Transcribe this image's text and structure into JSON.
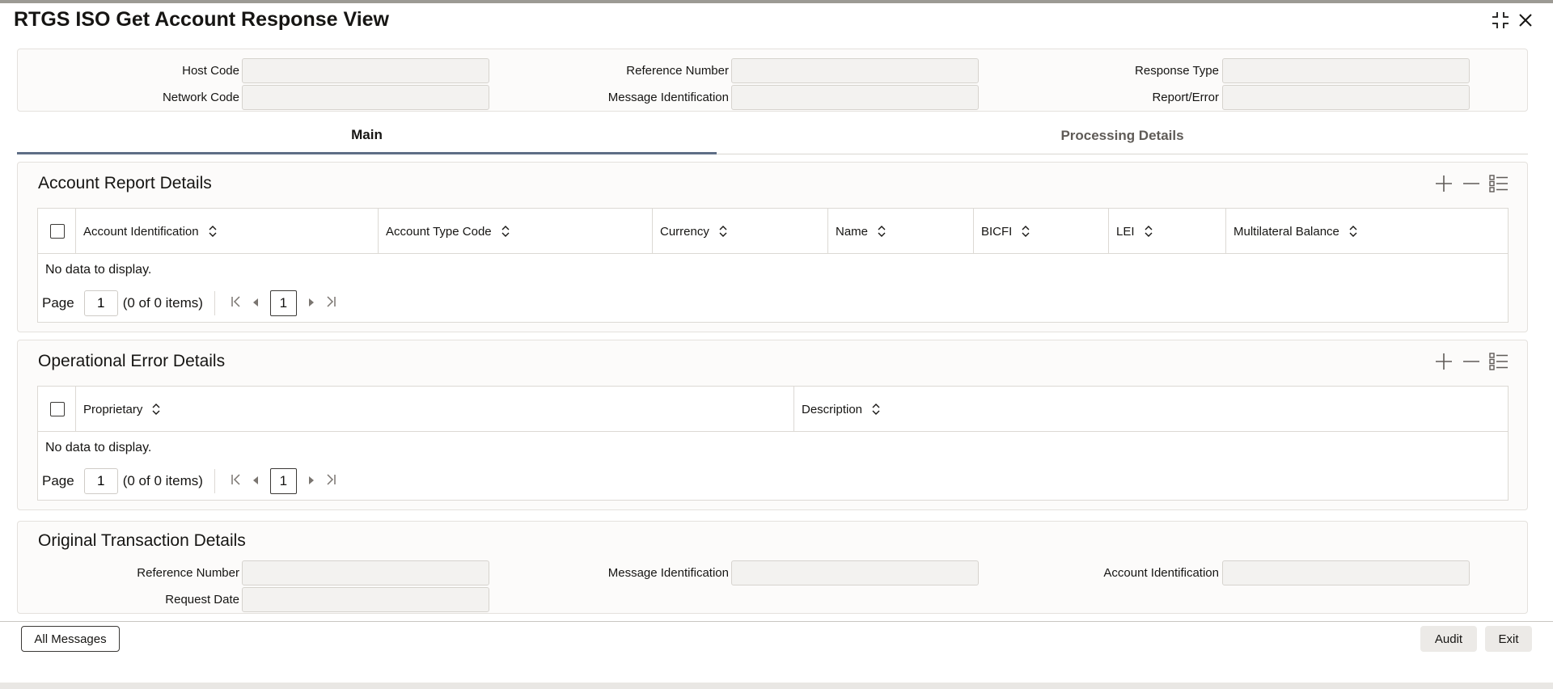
{
  "window": {
    "title": "RTGS ISO Get Account Response View"
  },
  "header_fields": {
    "host_code": {
      "label": "Host Code",
      "value": ""
    },
    "network_code": {
      "label": "Network Code",
      "value": ""
    },
    "reference_number": {
      "label": "Reference Number",
      "value": ""
    },
    "message_identification": {
      "label": "Message Identification",
      "value": ""
    },
    "response_type": {
      "label": "Response Type",
      "value": ""
    },
    "report_error": {
      "label": "Report/Error",
      "value": ""
    }
  },
  "tabs": [
    {
      "label": "Main",
      "active": true
    },
    {
      "label": "Processing Details",
      "active": false
    }
  ],
  "account_report": {
    "title": "Account Report Details",
    "columns": [
      "Account Identification",
      "Account Type Code",
      "Currency",
      "Name",
      "BICFI",
      "LEI",
      "Multilateral Balance"
    ],
    "empty_text": "No data to display.",
    "pager": {
      "label": "Page",
      "page": "1",
      "count": "(0 of 0 items)",
      "current": "1"
    }
  },
  "operational_error": {
    "title": "Operational Error Details",
    "columns": [
      "Proprietary",
      "Description"
    ],
    "empty_text": "No data to display.",
    "pager": {
      "label": "Page",
      "page": "1",
      "count": "(0 of 0 items)",
      "current": "1"
    }
  },
  "original_transaction": {
    "title": "Original Transaction Details",
    "reference_number": {
      "label": "Reference Number",
      "value": ""
    },
    "message_identification": {
      "label": "Message Identification",
      "value": ""
    },
    "account_identification": {
      "label": "Account Identification",
      "value": ""
    },
    "request_date": {
      "label": "Request Date",
      "value": ""
    }
  },
  "footer": {
    "all_messages": "All Messages",
    "audit": "Audit",
    "exit": "Exit"
  }
}
